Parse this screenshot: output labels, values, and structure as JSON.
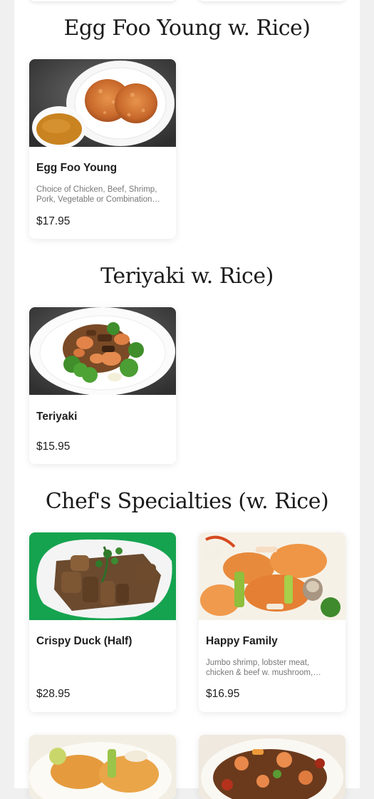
{
  "sections": [
    {
      "title": "Egg Foo Young  w. Rice)",
      "items": [
        {
          "name": "Egg Foo Young",
          "desc_line1": "Choice of Chicken, Beef, Shrimp,",
          "desc_line2": "Pork, Vegetable or Combination…",
          "price": "$17.95"
        }
      ]
    },
    {
      "title": "Teriyaki  w. Rice)",
      "items": [
        {
          "name": "Teriyaki",
          "price": "$15.95"
        }
      ]
    },
    {
      "title": "Chef's Specialties (w. Rice)",
      "items": [
        {
          "name": "Crispy Duck (Half)",
          "price": "$28.95"
        },
        {
          "name": "Happy Family",
          "desc_line1": "Jumbo shrimp, lobster meat,",
          "desc_line2": "chicken & beef w. mushroom,…",
          "price": "$16.95"
        }
      ]
    }
  ],
  "colors": {
    "page_bg": "#f0f0f0",
    "card_bg": "#ffffff",
    "text": "#1e1e1e",
    "desc": "#777777",
    "green_bg": "#15a34f"
  }
}
